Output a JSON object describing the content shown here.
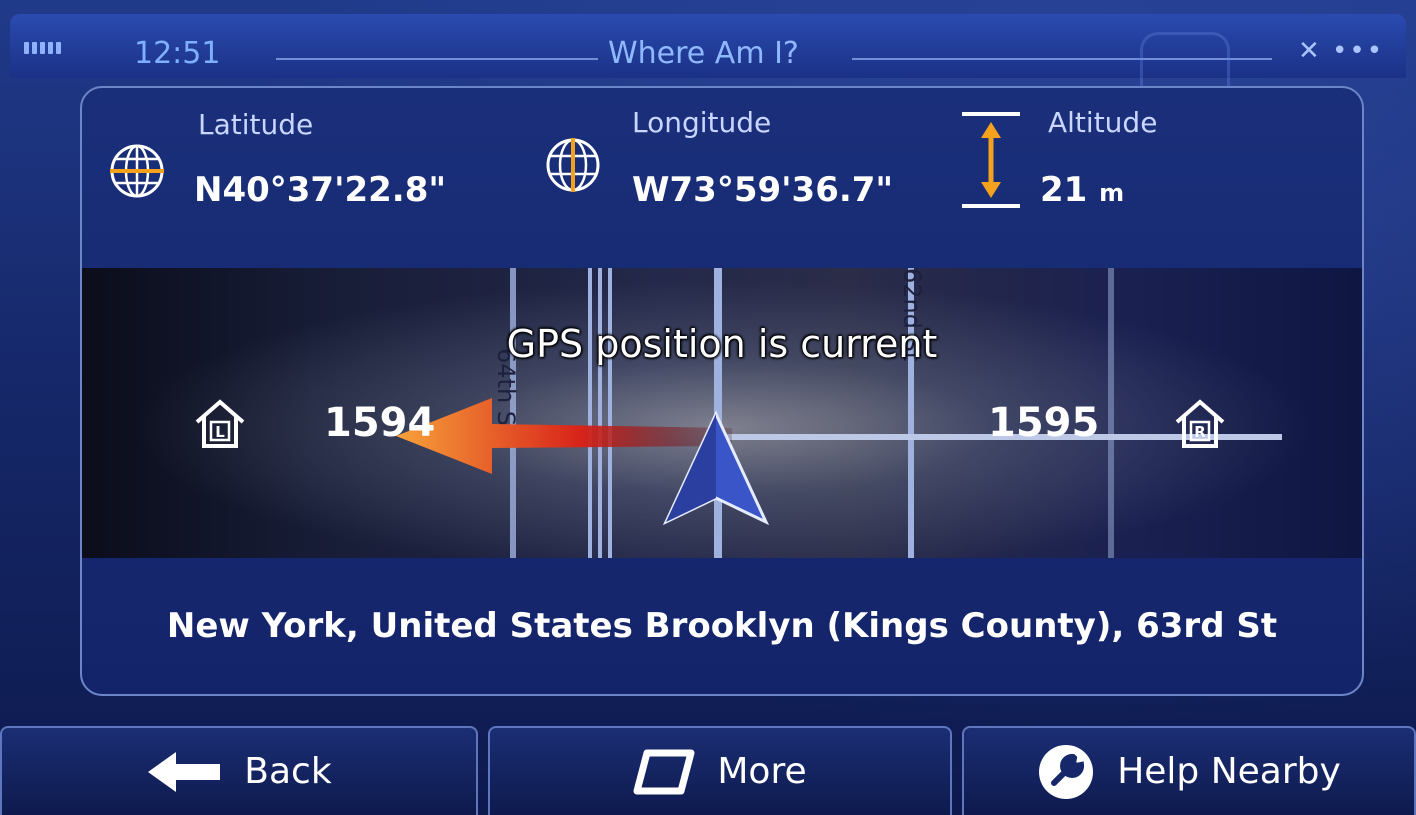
{
  "status_bar": {
    "time": "12:51",
    "title": "Where Am I?",
    "gps_indicator": "✕ •••"
  },
  "coordinates": {
    "latitude": {
      "label": "Latitude",
      "value": "N40°37'22.8\""
    },
    "longitude": {
      "label": "Longitude",
      "value": "W73°59'36.7\""
    },
    "altitude": {
      "label": "Altitude",
      "value": "21",
      "unit": "m"
    }
  },
  "map": {
    "gps_message": "GPS position is current",
    "street_left": "64th St",
    "street_right": "62nd St",
    "house_left": {
      "icon_letter": "L",
      "number": "1594"
    },
    "house_right": {
      "icon_letter": "R",
      "number": "1595"
    }
  },
  "address": "New York, United States Brooklyn (Kings County), 63rd St",
  "buttons": {
    "back": "Back",
    "more": "More",
    "help_nearby": "Help Nearby"
  },
  "colors": {
    "accent_orange": "#f4a21e",
    "route_red": "#d8231a",
    "arrow_blue": "#3a55c8"
  }
}
